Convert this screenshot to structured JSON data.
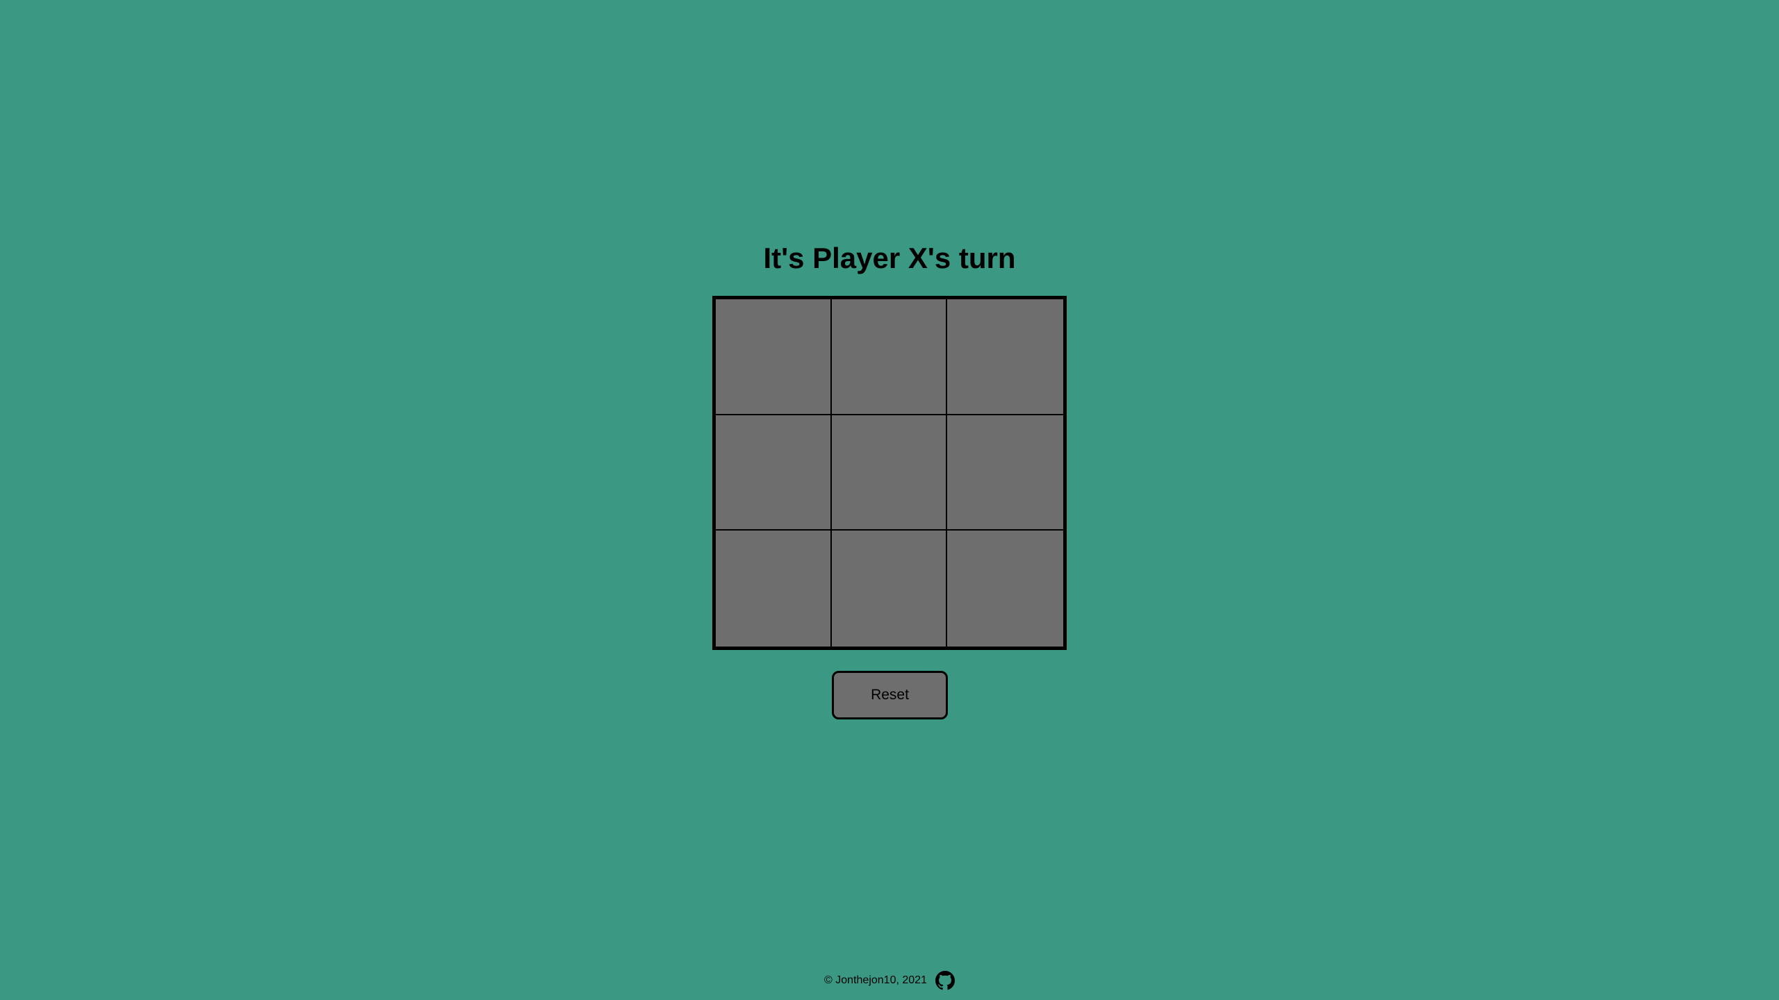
{
  "game": {
    "status": "It's Player X's turn",
    "board": [
      "",
      "",
      "",
      "",
      "",
      "",
      "",
      "",
      ""
    ]
  },
  "controls": {
    "reset_label": "Reset"
  },
  "footer": {
    "copyright": "© Jonthejon10, 2021",
    "link_icon": "github-icon"
  },
  "colors": {
    "background": "#3b9883",
    "cell": "#6e6e6e",
    "border": "#000000"
  }
}
